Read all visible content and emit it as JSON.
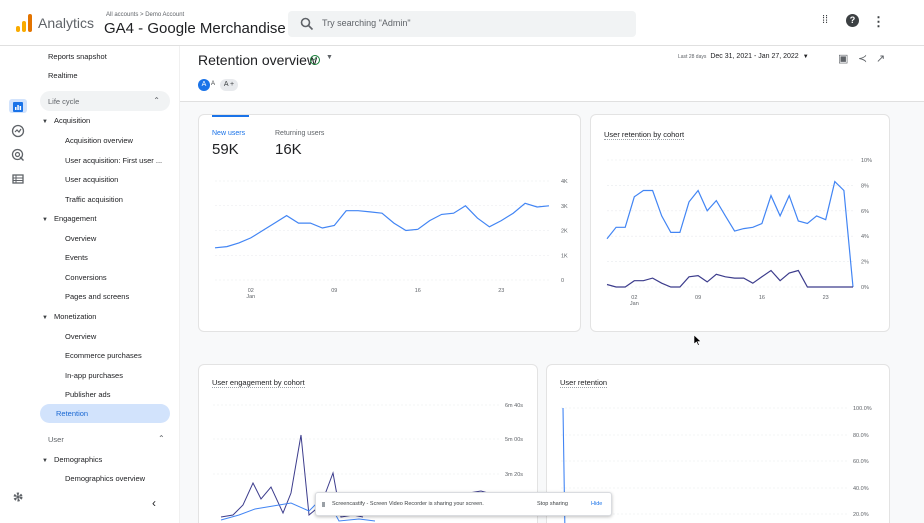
{
  "topbar": {
    "app_name": "Analytics",
    "breadcrumb": "All accounts > Demo Account",
    "property": "GA4 - Google Merchandise ...",
    "search_placeholder": "Try searching \"Admin\""
  },
  "sidebar": {
    "top_items": [
      "Reports snapshot",
      "Realtime"
    ],
    "lifecycle_header": "Life cycle",
    "acquisition": {
      "label": "Acquisition",
      "items": [
        "Acquisition overview",
        "User acquisition: First user ...",
        "User acquisition",
        "Traffic acquisition"
      ]
    },
    "engagement": {
      "label": "Engagement",
      "items": [
        "Overview",
        "Events",
        "Conversions",
        "Pages and screens"
      ]
    },
    "monetization": {
      "label": "Monetization",
      "items": [
        "Overview",
        "Ecommerce purchases",
        "In-app purchases",
        "Publisher ads"
      ]
    },
    "active_item": "Retention",
    "user_header": "User",
    "demographics": {
      "label": "Demographics",
      "items": [
        "Demographics overview"
      ]
    }
  },
  "header": {
    "title": "Retention overview",
    "avatar_letter": "A",
    "chip_letter": "A",
    "chip_plus": "A +",
    "date_range_prefix": "Last 28 days",
    "date_range": "Dec 31, 2021 - Jan 27, 2022"
  },
  "snackbar": {
    "message": "Screencastify - Screen Video Recorder is sharing your screen.",
    "stop_label": "Stop sharing",
    "hide_label": "Hide"
  },
  "colors": {
    "accent": "#1a73e8",
    "line_primary": "#4285f4",
    "line_secondary": "#3c3c8c"
  },
  "chart_data": [
    {
      "type": "line",
      "title": "",
      "tabs": [
        {
          "label": "New users",
          "value": "59K",
          "active": true
        },
        {
          "label": "Returning users",
          "value": "16K",
          "active": false
        }
      ],
      "x_ticks": [
        "02\nJan",
        "09",
        "16",
        "23"
      ],
      "y_ticks": [
        "0",
        "1K",
        "2K",
        "3K",
        "4K"
      ],
      "ylim": [
        0,
        4000
      ],
      "series": [
        {
          "values": [
            1300,
            1350,
            1500,
            1700,
            2000,
            2300,
            2600,
            2300,
            2300,
            2100,
            2200,
            2800,
            2800,
            2750,
            2700,
            2300,
            2000,
            2050,
            2400,
            2650,
            2700,
            3000,
            2500,
            2150,
            2400,
            2700,
            3100,
            2950,
            3000
          ]
        }
      ]
    },
    {
      "type": "line",
      "title": "User retention by cohort",
      "x_ticks": [
        "02\nJan",
        "09",
        "16",
        "23"
      ],
      "y_ticks": [
        "0%",
        "2%",
        "4%",
        "6%",
        "8%",
        "10%"
      ],
      "ylim": [
        0,
        10
      ],
      "series": [
        {
          "values": [
            3.8,
            4.7,
            4.7,
            7.1,
            7.6,
            7.6,
            5.6,
            4.3,
            4.3,
            6.7,
            7.6,
            6.0,
            6.8,
            5.6,
            4.4,
            4.6,
            4.7,
            5.0,
            7.2,
            5.6,
            7.2,
            5.2,
            5.0,
            5.6,
            5.3,
            8.3,
            7.6,
            0.0
          ]
        },
        {
          "values": [
            0.2,
            0.0,
            0.0,
            0.5,
            0.5,
            0.7,
            0.3,
            0.0,
            0.0,
            0.8,
            0.9,
            0.4,
            1.0,
            0.8,
            0.7,
            0.7,
            0.3,
            0.8,
            1.3,
            0.5,
            1.1,
            1.3,
            0.0,
            0.0,
            0.0,
            0.0,
            0.0,
            0.0
          ]
        }
      ]
    },
    {
      "type": "line",
      "title": "User engagement by cohort",
      "y_ticks": [
        "3m 20s",
        "5m 00s",
        "6m 40s"
      ]
    },
    {
      "type": "line",
      "title": "User retention",
      "y_ticks": [
        "20.0%",
        "40.0%",
        "60.0%",
        "80.0%",
        "100.0%"
      ]
    }
  ]
}
